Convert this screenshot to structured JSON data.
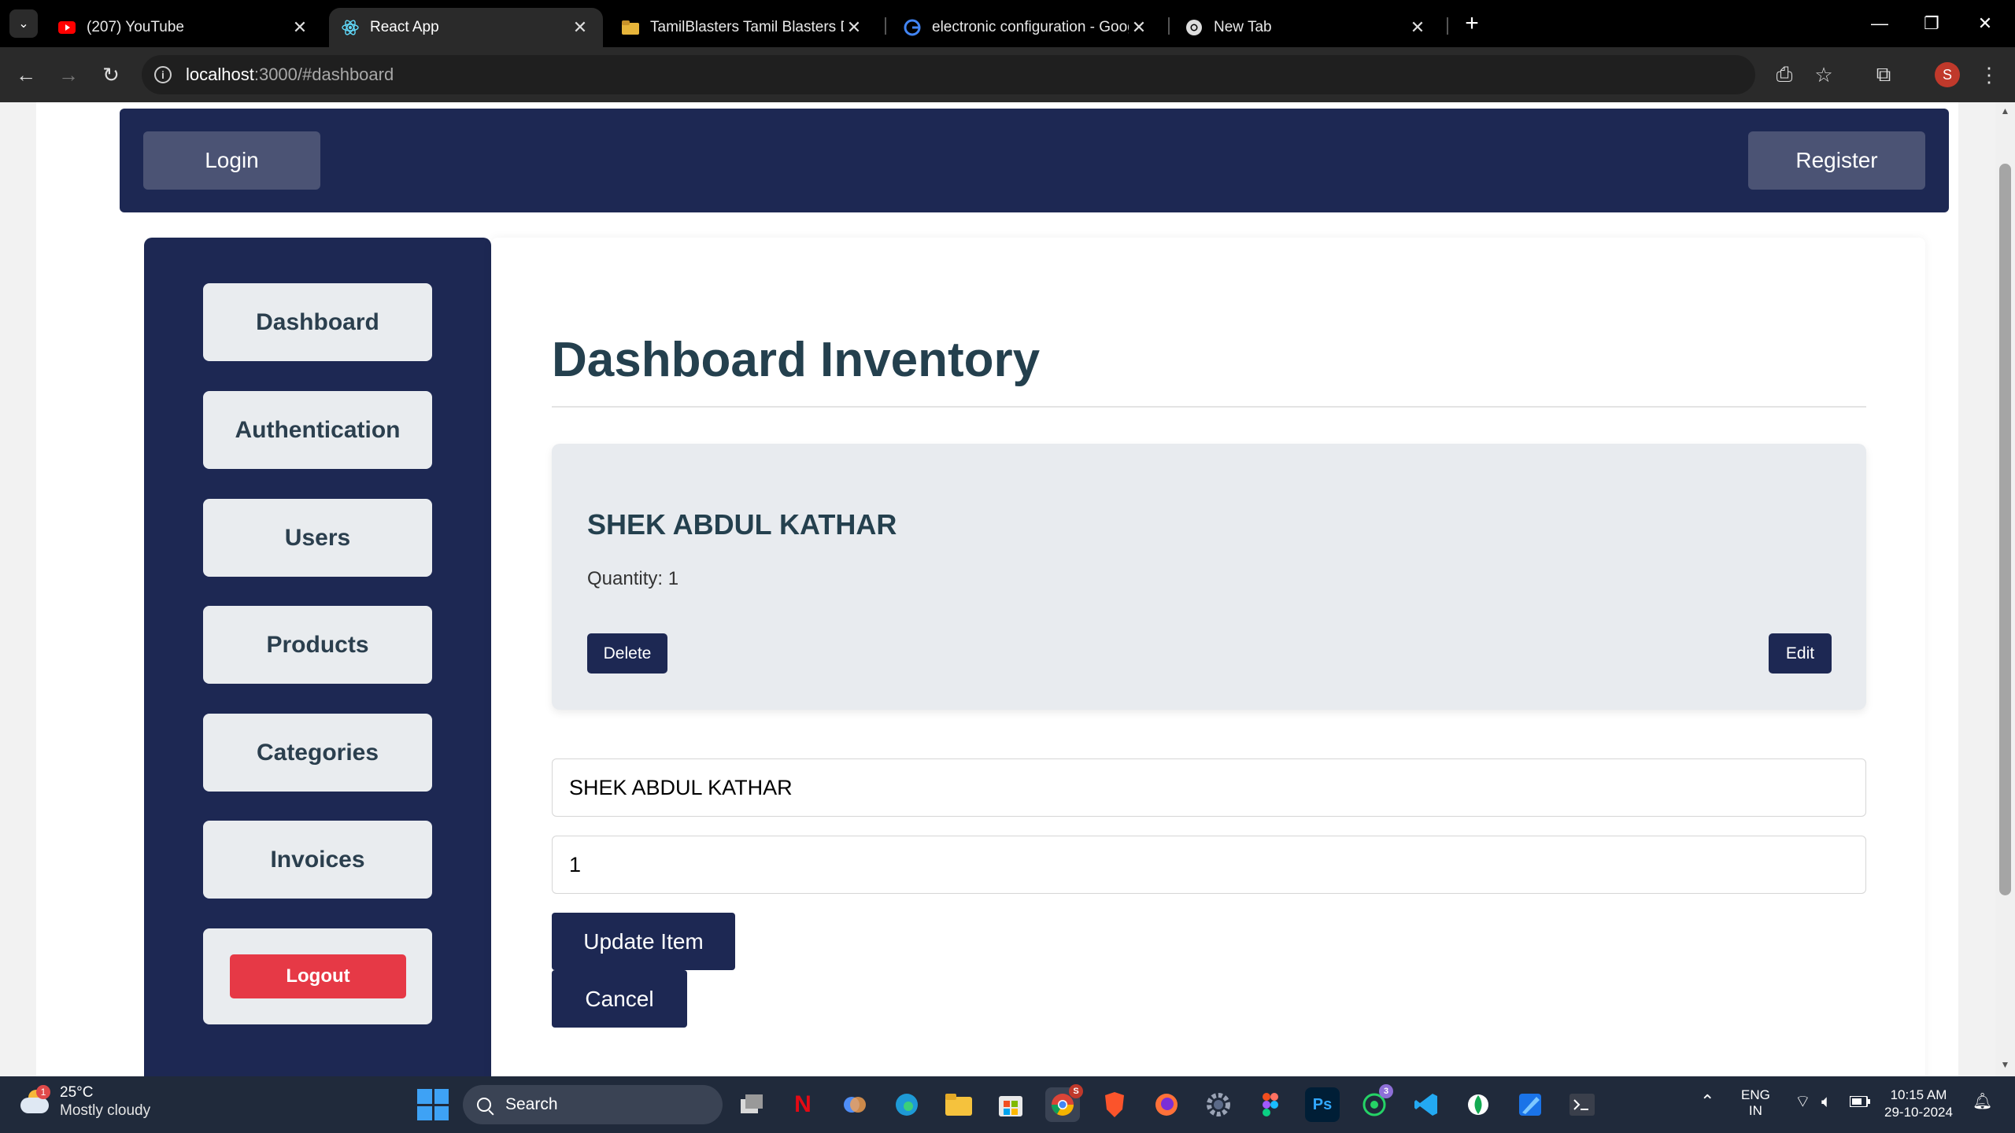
{
  "browser": {
    "tabs": [
      {
        "title": "(207) YouTube",
        "icon": "youtube-icon"
      },
      {
        "title": "React App",
        "icon": "react-icon"
      },
      {
        "title": "TamilBlasters Tamil Blasters Dow",
        "icon": "folder-icon"
      },
      {
        "title": "electronic configuration - Goog",
        "icon": "google-icon"
      },
      {
        "title": "New Tab",
        "icon": "chrome-icon"
      }
    ],
    "active_tab": 1,
    "url_host": "localhost",
    "url_path": ":3000/#dashboard",
    "profile_initial": "S"
  },
  "topnav": {
    "login_label": "Login",
    "register_label": "Register"
  },
  "sidebar": {
    "items": [
      {
        "label": "Dashboard"
      },
      {
        "label": "Authentication"
      },
      {
        "label": "Users"
      },
      {
        "label": "Products"
      },
      {
        "label": "Categories"
      },
      {
        "label": "Invoices"
      }
    ],
    "logout_label": "Logout"
  },
  "main": {
    "title": "Dashboard Inventory",
    "item": {
      "name": "SHEK ABDUL KATHAR",
      "quantity_label": "Quantity: ",
      "quantity": "1",
      "delete_label": "Delete",
      "edit_label": "Edit"
    },
    "form": {
      "name_value": "SHEK ABDUL KATHAR",
      "quantity_value": "1",
      "update_label": "Update Item",
      "cancel_label": "Cancel"
    }
  },
  "colors": {
    "navy": "#1d2853",
    "logout_red": "#e63946",
    "title_text": "#24404e"
  },
  "taskbar": {
    "weather_badge": "1",
    "temperature": "25°C",
    "condition": "Mostly cloudy",
    "search_label": "Search",
    "chrome_badge": "S",
    "whatsapp_badge": "3",
    "language_line1": "ENG",
    "language_line2": "IN",
    "time": "10:15 AM",
    "date": "29-10-2024"
  }
}
